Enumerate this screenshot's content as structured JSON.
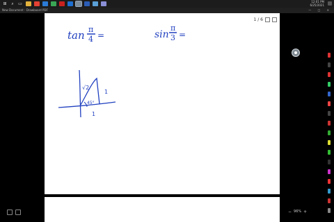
{
  "taskbar": {
    "start_icon": "windows-start-icon",
    "search_icon": "search-icon",
    "taskview_icon": "task-view-icon",
    "apps": [
      {
        "icon": "file-explorer-icon",
        "color": "#e2b23c"
      },
      {
        "icon": "chrome-icon",
        "color": "#e34133"
      },
      {
        "icon": "edge-icon",
        "color": "#2a7bd6"
      },
      {
        "icon": "camtasia-icon",
        "color": "#3aa655"
      },
      {
        "icon": "acrobat-icon",
        "color": "#c8221f"
      },
      {
        "icon": "outlook-icon",
        "color": "#1d6fd1"
      },
      {
        "icon": "drawboard-icon",
        "color": "#7c8b98",
        "active": true
      },
      {
        "icon": "word-icon",
        "color": "#2b5db7"
      },
      {
        "icon": "photos-icon",
        "color": "#5a9fd6"
      },
      {
        "icon": "teams-icon",
        "color": "#8b8fd6"
      }
    ],
    "clock_time": "12:01 PM",
    "clock_date": "6/25/2021"
  },
  "window": {
    "title": "New Document - Drawboard PDF",
    "controls": [
      "—",
      "□",
      "✕"
    ]
  },
  "page_indicator": "1 / 6",
  "zoom_level": "96%",
  "colors": {
    "ink": "#1f3fbf",
    "page": "#ffffff",
    "background": "#000000"
  },
  "handwriting": {
    "expr1_func": "tan",
    "expr1_num": "π",
    "expr1_den": "4",
    "equals": "=",
    "expr2_func": "sin",
    "expr2_num": "π",
    "expr2_den": "3",
    "hyp_label": "√2",
    "side_label": "1",
    "base_label": "1",
    "angle_label": "45°"
  },
  "toolbar_tools": [
    {
      "icon": "pen-tool-icon",
      "color": "#d33"
    },
    {
      "icon": "pen-tool-icon",
      "color": "#444"
    },
    {
      "icon": "pen-tool-icon",
      "color": "#d33"
    },
    {
      "icon": "pen-tool-icon",
      "color": "#3c6"
    },
    {
      "icon": "pen-tool-icon",
      "color": "#36c"
    },
    {
      "icon": "pen-tool-icon",
      "color": "#e44"
    },
    {
      "icon": "pen-tool-icon",
      "color": "#444"
    },
    {
      "icon": "pen-tool-icon",
      "color": "#c33"
    },
    {
      "icon": "pen-tool-icon",
      "color": "#3a3"
    },
    {
      "icon": "highlighter-icon",
      "color": "#dd3"
    },
    {
      "icon": "pen-tool-icon",
      "color": "#3b3"
    },
    {
      "icon": "pen-tool-icon",
      "color": "#333"
    },
    {
      "icon": "pen-tool-icon",
      "color": "#c3c"
    },
    {
      "icon": "pen-tool-icon",
      "color": "#e33"
    },
    {
      "icon": "pen-tool-icon",
      "color": "#39c"
    },
    {
      "icon": "pen-tool-icon",
      "color": "#c33"
    },
    {
      "icon": "eraser-icon",
      "color": "#888"
    }
  ]
}
